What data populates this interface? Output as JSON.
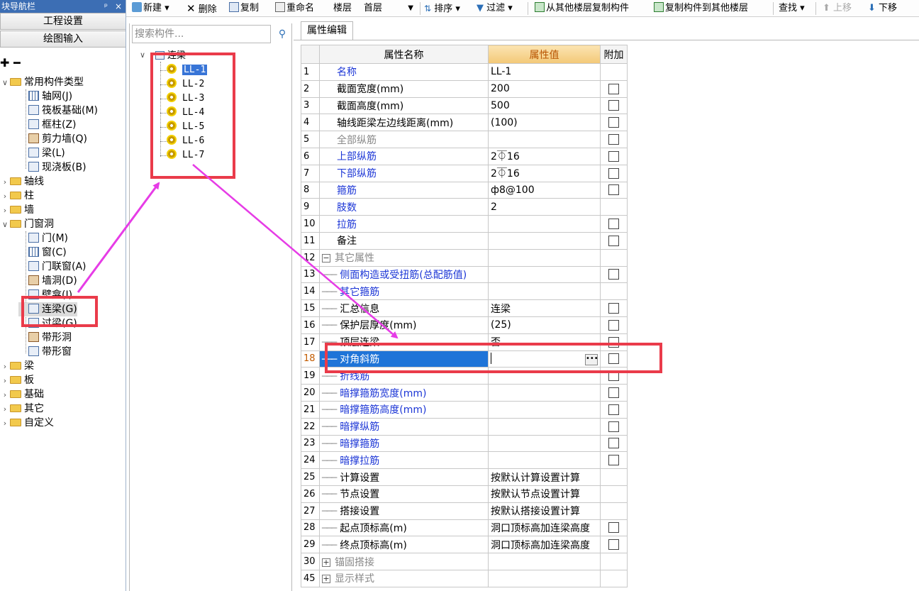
{
  "nav": {
    "title": "块导航栏",
    "pin": "ᵖ",
    "close": "×",
    "btn_project": "工程设置",
    "btn_drawing": "绘图输入",
    "tools": "✚ ━",
    "tree": [
      {
        "label": "常用构件类型",
        "expanded": true
      },
      {
        "label": "轴网(J)"
      },
      {
        "label": "筏板基础(M)"
      },
      {
        "label": "框柱(Z)"
      },
      {
        "label": "剪力墙(Q)"
      },
      {
        "label": "梁(L)"
      },
      {
        "label": "现浇板(B)"
      },
      {
        "label": "轴线"
      },
      {
        "label": "柱"
      },
      {
        "label": "墙"
      },
      {
        "label": "门窗洞",
        "expanded": true
      },
      {
        "label": "门(M)"
      },
      {
        "label": "窗(C)"
      },
      {
        "label": "门联窗(A)"
      },
      {
        "label": "墙洞(D)"
      },
      {
        "label": "壁龛(I)"
      },
      {
        "label": "连梁(G)",
        "selected": true
      },
      {
        "label": "过梁(G)"
      },
      {
        "label": "带形洞"
      },
      {
        "label": "带形窗"
      },
      {
        "label": "梁"
      },
      {
        "label": "板"
      },
      {
        "label": "基础"
      },
      {
        "label": "其它"
      },
      {
        "label": "自定义"
      }
    ]
  },
  "toolbar": {
    "new": "新建",
    "delete": "删除",
    "copy": "复制",
    "rename": "重命名",
    "floor_label": "楼层",
    "floor_value": "首层",
    "sort": "排序",
    "filter": "过滤",
    "copy_from_floor": "从其他楼层复制构件",
    "copy_to_floor": "复制构件到其他楼层",
    "find": "查找",
    "move_up": "上移",
    "move_down": "下移"
  },
  "complist": {
    "search_placeholder": "搜索构件...",
    "root": "连梁",
    "items": [
      "LL-1",
      "LL-2",
      "LL-3",
      "LL-4",
      "LL-5",
      "LL-6",
      "LL-7"
    ],
    "selected_index": 0
  },
  "props": {
    "tab": "属性编辑",
    "col_name": "属性名称",
    "col_value": "属性值",
    "col_extra": "附加",
    "rows": [
      {
        "num": "1",
        "name": "名称",
        "value": "LL-1",
        "style": "blue",
        "checkbox": false
      },
      {
        "num": "2",
        "name": "截面宽度(mm)",
        "value": "200",
        "style": "black",
        "checkbox": true
      },
      {
        "num": "3",
        "name": "截面高度(mm)",
        "value": "500",
        "style": "black",
        "checkbox": true
      },
      {
        "num": "4",
        "name": "轴线距梁左边线距离(mm)",
        "value": "(100)",
        "style": "black",
        "checkbox": true
      },
      {
        "num": "5",
        "name": "全部纵筋",
        "value": "",
        "style": "gray",
        "checkbox": true
      },
      {
        "num": "6",
        "name": "上部纵筋",
        "value": "2⏁16",
        "style": "blue",
        "checkbox": true
      },
      {
        "num": "7",
        "name": "下部纵筋",
        "value": "2⏁16",
        "style": "blue",
        "checkbox": true
      },
      {
        "num": "8",
        "name": "箍筋",
        "value": "ф8@100",
        "style": "blue",
        "checkbox": true
      },
      {
        "num": "9",
        "name": "肢数",
        "value": "2",
        "style": "blue",
        "checkbox": false
      },
      {
        "num": "10",
        "name": "拉筋",
        "value": "",
        "style": "blue",
        "checkbox": true
      },
      {
        "num": "11",
        "name": "备注",
        "value": "",
        "style": "black",
        "checkbox": true
      },
      {
        "num": "12",
        "name": "其它属性",
        "value": "",
        "style": "gray",
        "checkbox": false,
        "group": "−"
      },
      {
        "num": "13",
        "name": "侧面构造或受扭筋(总配筋值)",
        "value": "",
        "style": "blue",
        "checkbox": true,
        "child": true
      },
      {
        "num": "14",
        "name": "其它箍筋",
        "value": "",
        "style": "blue",
        "checkbox": false,
        "child": true
      },
      {
        "num": "15",
        "name": "汇总信息",
        "value": "连梁",
        "style": "black",
        "checkbox": true,
        "child": true
      },
      {
        "num": "16",
        "name": "保护层厚度(mm)",
        "value": "(25)",
        "style": "black",
        "checkbox": true,
        "child": true
      },
      {
        "num": "17",
        "name": "顶层连梁",
        "value": "否",
        "style": "black",
        "checkbox": true,
        "child": true
      },
      {
        "num": "18",
        "name": "对角斜筋",
        "value": "",
        "style": "selected",
        "checkbox": true,
        "child": true
      },
      {
        "num": "19",
        "name": "折线筋",
        "value": "",
        "style": "blue",
        "checkbox": true,
        "child": true
      },
      {
        "num": "20",
        "name": "暗撑箍筋宽度(mm)",
        "value": "",
        "style": "blue",
        "checkbox": true,
        "child": true
      },
      {
        "num": "21",
        "name": "暗撑箍筋高度(mm)",
        "value": "",
        "style": "blue",
        "checkbox": true,
        "child": true
      },
      {
        "num": "22",
        "name": "暗撑纵筋",
        "value": "",
        "style": "blue",
        "checkbox": true,
        "child": true
      },
      {
        "num": "23",
        "name": "暗撑箍筋",
        "value": "",
        "style": "blue",
        "checkbox": true,
        "child": true
      },
      {
        "num": "24",
        "name": "暗撑拉筋",
        "value": "",
        "style": "blue",
        "checkbox": true,
        "child": true
      },
      {
        "num": "25",
        "name": "计算设置",
        "value": "按默认计算设置计算",
        "style": "black",
        "checkbox": false,
        "child": true
      },
      {
        "num": "26",
        "name": "节点设置",
        "value": "按默认节点设置计算",
        "style": "black",
        "checkbox": false,
        "child": true
      },
      {
        "num": "27",
        "name": "搭接设置",
        "value": "按默认搭接设置计算",
        "style": "black",
        "checkbox": false,
        "child": true
      },
      {
        "num": "28",
        "name": "起点顶标高(m)",
        "value": "洞口顶标高加连梁高度",
        "style": "black",
        "checkbox": true,
        "child": true
      },
      {
        "num": "29",
        "name": "终点顶标高(m)",
        "value": "洞口顶标高加连梁高度",
        "style": "black",
        "checkbox": true,
        "child": true
      },
      {
        "num": "30",
        "name": "锚固搭接",
        "value": "",
        "style": "gray",
        "checkbox": false,
        "group": "+"
      },
      {
        "num": "45",
        "name": "显示样式",
        "value": "",
        "style": "gray",
        "checkbox": false,
        "group": "+"
      }
    ]
  },
  "colors": {
    "annotation_red": "#ea3b4a",
    "annotation_arrow": "#e63ce6",
    "selection_blue": "#1f74d8",
    "property_blue": "#1c36d6"
  }
}
